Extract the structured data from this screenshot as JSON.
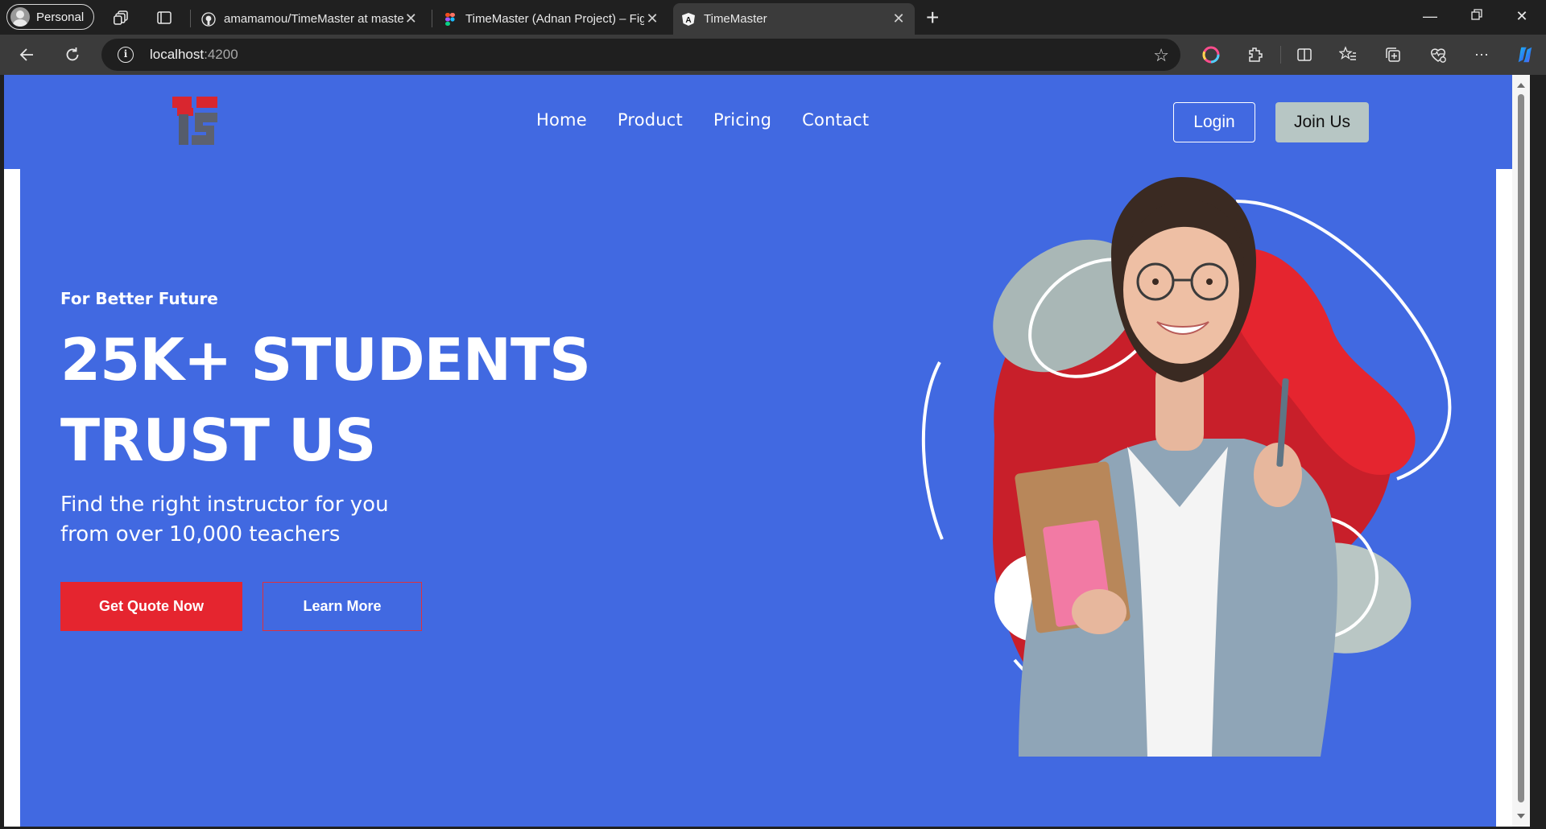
{
  "browser": {
    "profile_label": "Personal",
    "tabs": [
      {
        "title": "amamamou/TimeMaster at maste",
        "favicon": "github-icon"
      },
      {
        "title": "TimeMaster (Adnan Project) – Fig",
        "favicon": "figma-icon"
      },
      {
        "title": "TimeMaster",
        "favicon": "angular-icon",
        "active": true
      }
    ],
    "address": {
      "host": "localhost",
      "port": ":4200"
    }
  },
  "site": {
    "nav": [
      "Home",
      "Product",
      "Pricing",
      "Contact"
    ],
    "login_label": "Login",
    "join_label": "Join Us"
  },
  "hero": {
    "eyebrow": "For Better Future",
    "headline_line1": "25K+ STUDENTS",
    "headline_line2": "TRUST US",
    "subcopy_line1": "Find the right instructor for you",
    "subcopy_line2": "from over 10,000 teachers",
    "primary_cta": "Get Quote Now",
    "secondary_cta": "Learn More"
  },
  "colors": {
    "hero_bg": "#4169e1",
    "accent_red": "#e5252f",
    "join_bg": "#b7c6c4"
  }
}
